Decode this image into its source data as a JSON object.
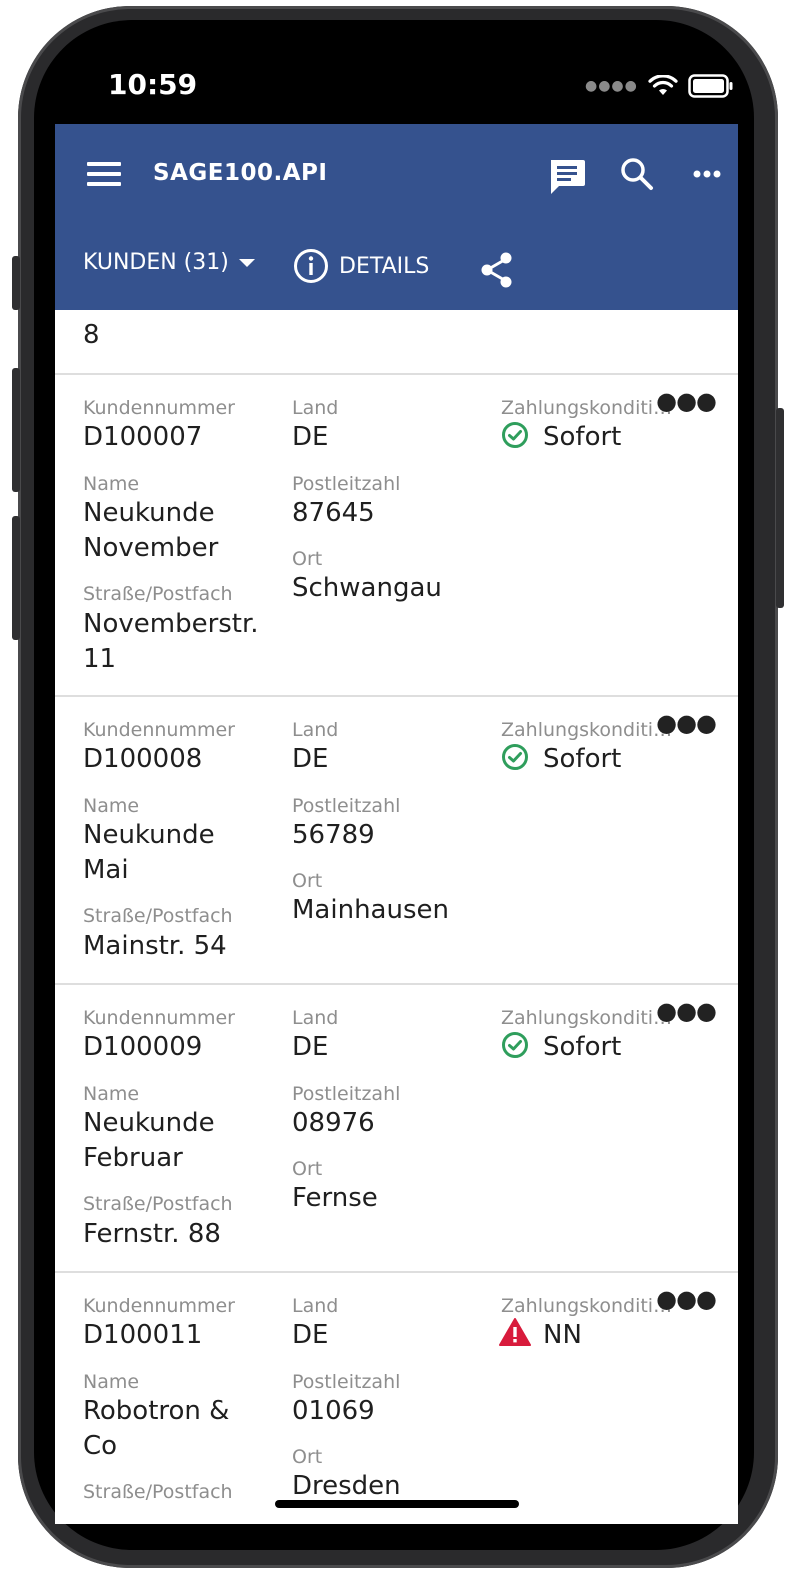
{
  "status_bar": {
    "time": "10:59"
  },
  "app_bar": {
    "title": "SAGE100.API",
    "entity_selector": "KUNDEN (31)",
    "details_label": "DETAILS"
  },
  "labels": {
    "kundennummer": "Kundennummer",
    "land": "Land",
    "zahlung": "Zahlungskonditi…",
    "name": "Name",
    "plz": "Postleitzahl",
    "strasse": "Straße/Postfach",
    "ort": "Ort"
  },
  "partial_top": {
    "street_line2": "8"
  },
  "customers": [
    {
      "nummer": "D100007",
      "land": "DE",
      "zahlung": "Sofort",
      "zahlung_status": "ok",
      "name1": "Neukunde",
      "name2": "November",
      "plz": "87645",
      "ort": "Schwangau",
      "strasse1": "Novemberstr.",
      "strasse2": "11"
    },
    {
      "nummer": "D100008",
      "land": "DE",
      "zahlung": "Sofort",
      "zahlung_status": "ok",
      "name1": "Neukunde",
      "name2": "Mai",
      "plz": "56789",
      "ort": "Mainhausen",
      "strasse1": "Mainstr. 54"
    },
    {
      "nummer": "D100009",
      "land": "DE",
      "zahlung": "Sofort",
      "zahlung_status": "ok",
      "name1": "Neukunde",
      "name2": "Februar",
      "plz": "08976",
      "ort": "Fernse",
      "strasse1": "Fernstr. 88"
    },
    {
      "nummer": "D100011",
      "land": "DE",
      "zahlung": "NN",
      "zahlung_status": "warning",
      "name1": "Robotron &",
      "name2": "Co",
      "plz": "01069",
      "ort": "Dresden"
    }
  ],
  "colors": {
    "app_bar": "#35528e",
    "ok": "#2f9e5c",
    "warning": "#d81b3c"
  }
}
